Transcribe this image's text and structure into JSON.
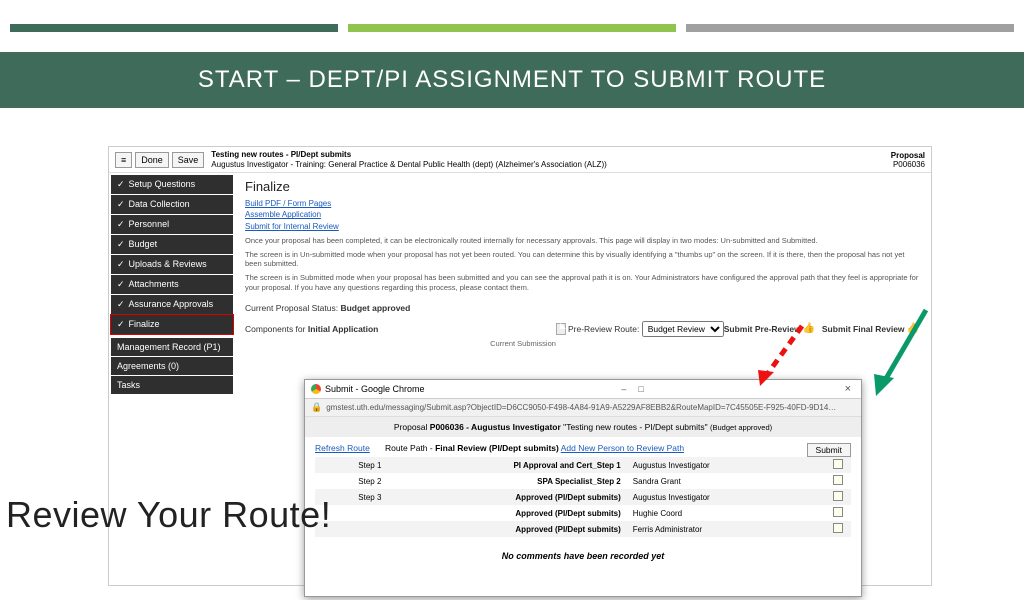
{
  "slide": {
    "title": "START – DEPT/PI ASSIGNMENT  TO SUBMIT ROUTE",
    "callout": "Review Your Route!"
  },
  "app": {
    "buttons": {
      "menu": "≡",
      "done": "Done",
      "save": "Save"
    },
    "meta": {
      "title": "Testing new routes - PI/Dept submits",
      "subtitle": "Augustus Investigator - Training: General Practice & Dental Public Health (dept) (Alzheimer's Association (ALZ))"
    },
    "right": {
      "type": "Proposal",
      "id": "P006036"
    },
    "sidebar": [
      "Setup Questions",
      "Data Collection",
      "Personnel",
      "Budget",
      "Uploads & Reviews",
      "Attachments",
      "Assurance Approvals",
      "Finalize",
      "Management Record (P1)",
      "Agreements (0)",
      "Tasks"
    ],
    "finalize": {
      "heading": "Finalize",
      "links": [
        "Build PDF / Form Pages",
        "Assemble Application",
        "Submit for Internal Review"
      ],
      "p1": "Once your proposal has been completed, it can be electronically routed internally for necessary approvals. This page will display in two modes: Un-submitted and Submitted.",
      "p2": "The screen is in Un-submitted mode when your proposal has not yet been routed. You can determine this by visually identifying a \"thumbs up\" on the screen. If it is there, then the proposal has not yet been submitted.",
      "p3": "The screen is in Submitted mode when your proposal has been submitted and you can see the approval path it is on. Your Administrators have configured the approval path that they feel is appropriate for your proposal. If you have any questions regarding this process, please contact them.",
      "status_label": "Current Proposal Status:",
      "status_value": "Budget approved",
      "components_label": "Components for",
      "components_value": "Initial Application",
      "preroute": "Pre-Review Route:",
      "preroute_value": "Budget Review",
      "submit_pre": "Submit Pre-Review",
      "submit_final": "Submit Final Review",
      "cur_sub": "Current Submission"
    }
  },
  "popup": {
    "title": "Submit - Google Chrome",
    "url": "gmstest.uth.edu/messaging/Submit.asp?ObjectID=D6CC9050-F498-4A84-91A9-A5229AF8EBB2&RouteMapID=7C45505E-F925-40FD-9D14…",
    "head_prefix": "Proposal ",
    "head_id": "P006036 - Augustus Investigator",
    "head_quote": "\"Testing new routes - PI/Dept submits\"",
    "head_status": "(Budget approved)",
    "refresh": "Refresh Route",
    "route_path": "Route Path - ",
    "route_name": "Final Review (PI/Dept submits)",
    "add_person": "Add New Person to Review Path",
    "submit": "Submit",
    "rows": [
      {
        "step": "Step 1",
        "role": "PI Approval and Cert_Step 1",
        "name": "Augustus Investigator"
      },
      {
        "step": "Step 2",
        "role": "SPA Specialist_Step 2",
        "name": "Sandra Grant"
      },
      {
        "step": "Step 3",
        "role": "Approved (PI/Dept submits)",
        "name": "Augustus Investigator"
      },
      {
        "step": "",
        "role": "Approved (PI/Dept submits)",
        "name": "Hughie Coord"
      },
      {
        "step": "",
        "role": "Approved (PI/Dept submits)",
        "name": "Ferris Administrator"
      }
    ],
    "no_comments": "No comments have been recorded yet"
  }
}
